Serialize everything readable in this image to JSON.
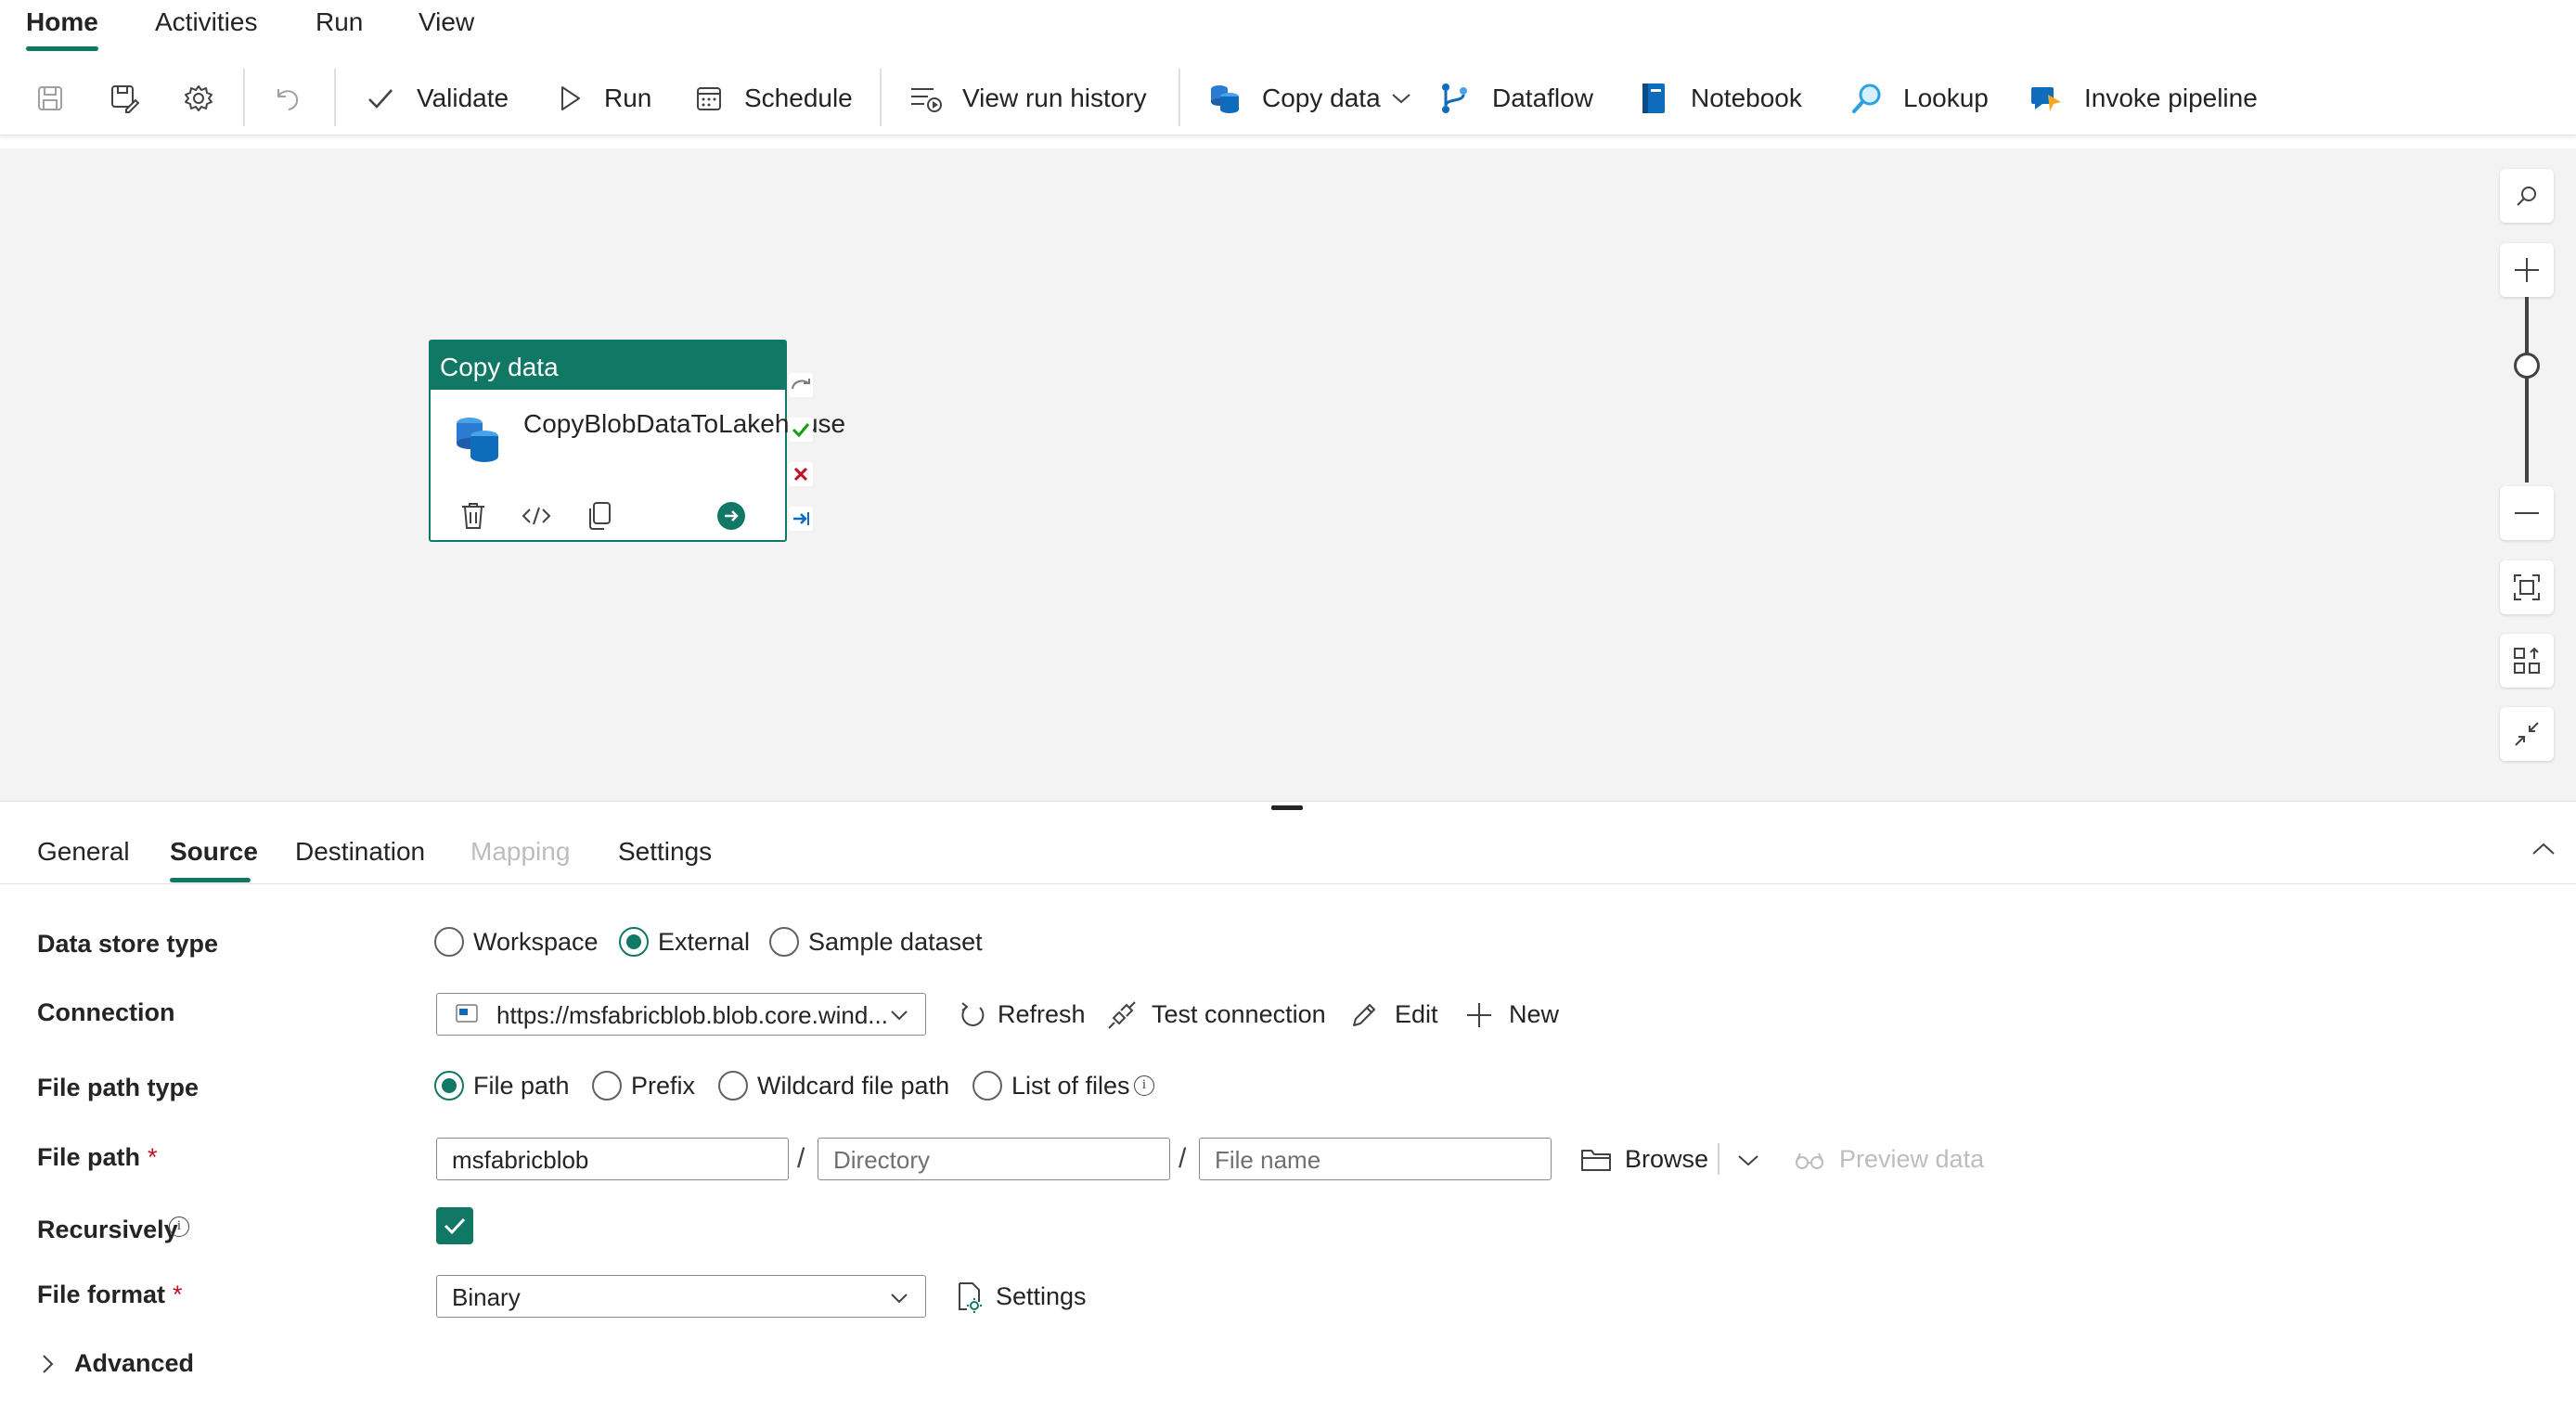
{
  "menu": {
    "tabs": [
      {
        "label": "Home",
        "active": true
      },
      {
        "label": "Activities",
        "active": false
      },
      {
        "label": "Run",
        "active": false
      },
      {
        "label": "View",
        "active": false
      }
    ]
  },
  "toolbar": {
    "save_icon": "save-icon",
    "save_as_icon": "save-as-icon",
    "settings_icon": "gear-icon",
    "undo_icon": "undo-icon",
    "validate": "Validate",
    "run": "Run",
    "schedule": "Schedule",
    "view_run_history": "View run history",
    "copy_data": "Copy data",
    "dataflow": "Dataflow",
    "notebook": "Notebook",
    "lookup": "Lookup",
    "invoke_pipeline": "Invoke pipeline"
  },
  "canvas": {
    "activity": {
      "type_label": "Copy data",
      "name": "CopyBlobDataToLakehouse",
      "actions": [
        "delete-icon",
        "code-icon",
        "copy-icon",
        "arrow-right-circle-icon"
      ],
      "handles": [
        "skip-icon",
        "success-icon",
        "fail-icon",
        "completion-icon"
      ]
    },
    "zoom_controls": [
      "search-icon",
      "zoom-in-icon",
      "zoom-out-icon",
      "fit-to-screen-icon",
      "auto-align-icon",
      "collapse-icon"
    ],
    "zoom_level_fraction": 0.5
  },
  "panel": {
    "tabs": [
      {
        "label": "General",
        "state": "normal"
      },
      {
        "label": "Source",
        "state": "active"
      },
      {
        "label": "Destination",
        "state": "normal"
      },
      {
        "label": "Mapping",
        "state": "disabled"
      },
      {
        "label": "Settings",
        "state": "normal"
      }
    ],
    "form": {
      "data_store_type": {
        "label": "Data store type",
        "options": [
          "Workspace",
          "External",
          "Sample dataset"
        ],
        "selected": "External"
      },
      "connection": {
        "label": "Connection",
        "value": "https://msfabricblob.blob.core.wind...",
        "refresh": "Refresh",
        "test_connection": "Test connection",
        "edit": "Edit",
        "new": "New"
      },
      "file_path_type": {
        "label": "File path type",
        "options": [
          "File path",
          "Prefix",
          "Wildcard file path",
          "List of files"
        ],
        "selected": "File path"
      },
      "file_path": {
        "label": "File path",
        "required_mark": "*",
        "container": "msfabricblob",
        "directory_placeholder": "Directory",
        "file_name_placeholder": "File name",
        "separator": "/",
        "browse": "Browse",
        "preview_data": "Preview data"
      },
      "recursively": {
        "label": "Recursively",
        "checked": true
      },
      "file_format": {
        "label": "File format",
        "required_mark": "*",
        "value": "Binary",
        "settings": "Settings"
      },
      "advanced": {
        "label": "Advanced"
      }
    }
  },
  "colors": {
    "accent": "#117865",
    "fail": "#c50f1f",
    "link_blue": "#0f6cbd"
  }
}
